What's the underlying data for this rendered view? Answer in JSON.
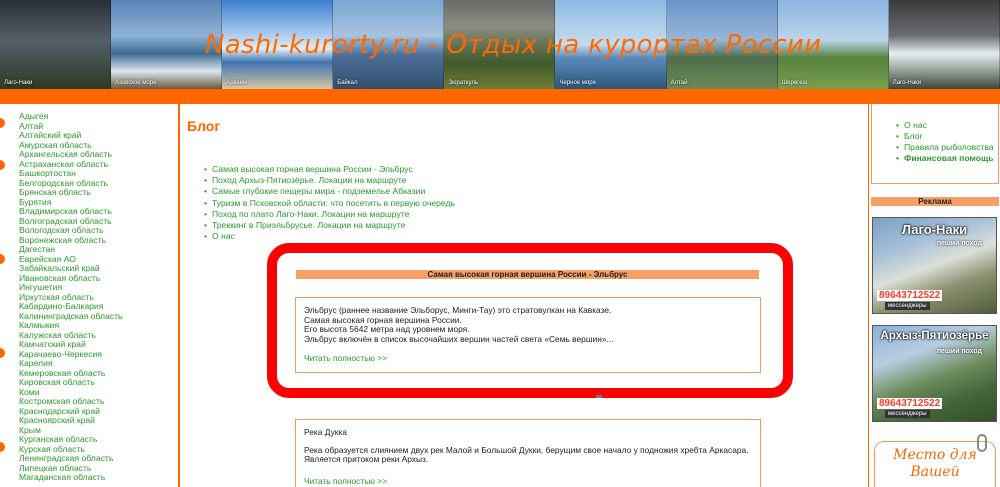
{
  "site": {
    "title": "Nashi-kurorty.ru - Отдых на курортах России"
  },
  "banner": {
    "captions": [
      "Лаго-Наки",
      "Азовское море",
      "Аркаим",
      "Байкал",
      "Зюраткуль",
      "Черное море",
      "Алтай",
      "Шерегеш",
      "Лаго-Наки"
    ]
  },
  "sidebar": {
    "regions": [
      "Адыгея",
      "Алтай",
      "Алтайский край",
      "Амурская область",
      "Архангельская область",
      "Астраханская область",
      "Башкортостан",
      "Белгородская область",
      "Брянская область",
      "Бурятия",
      "Владимирская область",
      "Волгоградская область",
      "Вологодская область",
      "Воронежская область",
      "Дагестан",
      "Еврейская АО",
      "Забайкальский край",
      "Ивановская область",
      "Ингушетия",
      "Иркутская область",
      "Кабардино-Балкария",
      "Калининградская область",
      "Калмыкия",
      "Калужская область",
      "Камчатский край",
      "Карачаево-Черкесия",
      "Карелия",
      "Кемеровская область",
      "Кировская область",
      "Коми",
      "Костромская область",
      "Краснодарский край",
      "Красноярский край",
      "Крым",
      "Курганская область",
      "Курская область",
      "Ленинградская область",
      "Липецкая область",
      "Магаданская область"
    ]
  },
  "main": {
    "heading": "Блог",
    "posts": [
      "Самая высокая горная вершина России - Эльбрус",
      "Поход Архыз-Пятиозёрье. Локации на маршруте",
      "Самые глубокие пещеры мира - подземелье Абхазии",
      "Туризм в Псковской области: что посетить в первую очередь",
      "Поход по плато Лаго-Наки. Локации на маршруте",
      "Треккинг в Приэльбрусье. Локации на маршруте",
      "О нас"
    ],
    "card1": {
      "title": "Самая высокая горная вершина России - Эльбрус",
      "lines": [
        "Эльбрус (раннее название Эльборус, Минги-Тау) это стратовулкан на Кавказе.",
        "Самая высокая горная вершина России.",
        "Его высота 5642 метра над уровнем моря.",
        "Эльбрус включён в список высочайших вершин частей света «Семь вершин»..."
      ],
      "more": "Читать полностью >>"
    },
    "card2": {
      "title": "Река Дукка",
      "lines": [
        "Река образуется слиянием двух рек Малой и Большой Дукки, берущим свое начало у подножия хребта Аркасара.",
        "Является притоком реки Архыз."
      ],
      "more": "Читать полностью >>"
    }
  },
  "right": {
    "menu": [
      "О нас",
      "Блог",
      "Правила рыболовства",
      "Финансовая помощь"
    ],
    "ads_label": "Реклама",
    "ad1": {
      "title": "Лаго-Наки",
      "subtitle": "пеший поход",
      "phone": "89643712522",
      "note": "мессенджеры"
    },
    "ad2": {
      "title": "Архыз-Пятиозёрье",
      "subtitle": "пеший поход",
      "phone": "89643712522",
      "note": "мессенджеры"
    },
    "place": {
      "line1": "Место для",
      "line2": "Вашей"
    }
  },
  "colors": {
    "accent": "#ff6600",
    "link": "#2a9a2a",
    "highlight": "#ff0000"
  }
}
